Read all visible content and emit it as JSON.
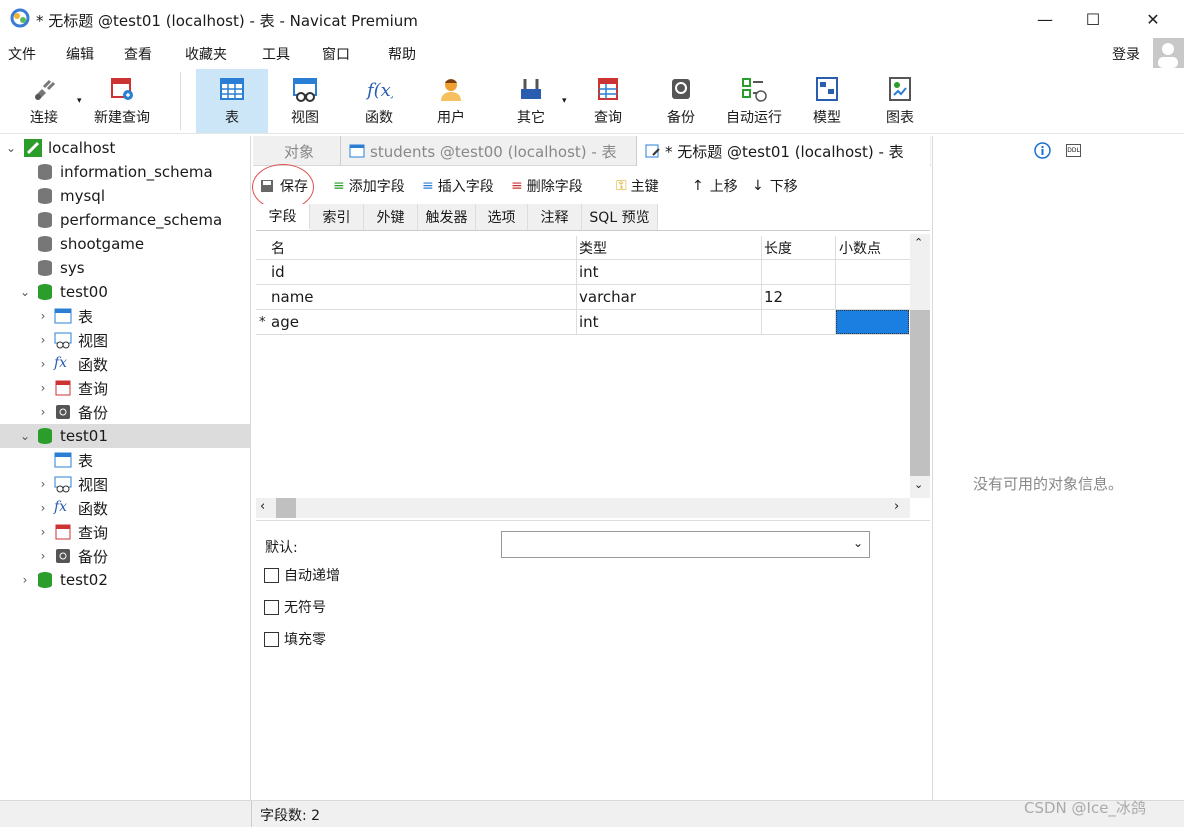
{
  "window": {
    "title": "* 无标题 @test01 (localhost) - 表 - Navicat Premium"
  },
  "menu": [
    "文件",
    "编辑",
    "查看",
    "收藏夹",
    "工具",
    "窗口",
    "帮助"
  ],
  "login": "登录",
  "toolbar": [
    "连接",
    "新建查询",
    "表",
    "视图",
    "函数",
    "用户",
    "其它",
    "查询",
    "备份",
    "自动运行",
    "模型",
    "图表"
  ],
  "tree": {
    "root": "localhost",
    "dbs_top": [
      "information_schema",
      "mysql",
      "performance_schema",
      "shootgame",
      "sys"
    ],
    "test00": "test00",
    "test00_children": [
      "表",
      "视图",
      "函数",
      "查询",
      "备份"
    ],
    "test01": "test01",
    "test01_children": [
      "表",
      "视图",
      "函数",
      "查询",
      "备份"
    ],
    "test02": "test02"
  },
  "tabs": {
    "objects": "对象",
    "t1": "students @test00 (localhost) - 表",
    "t2": "* 无标题 @test01 (localhost) - 表"
  },
  "edit_toolbar": {
    "save": "保存",
    "add": "添加字段",
    "insert": "插入字段",
    "delete": "删除字段",
    "pk": "主键",
    "up": "上移",
    "down": "下移"
  },
  "subtabs": [
    "字段",
    "索引",
    "外键",
    "触发器",
    "选项",
    "注释",
    "SQL 预览"
  ],
  "grid": {
    "headers": [
      "名",
      "类型",
      "长度",
      "小数点"
    ],
    "rows": [
      {
        "marker": "",
        "name": "id",
        "type": "int",
        "length": ""
      },
      {
        "marker": "",
        "name": "name",
        "type": "varchar",
        "length": "12"
      },
      {
        "marker": "*",
        "name": "age",
        "type": "int",
        "length": ""
      }
    ]
  },
  "props": {
    "default_label": "默认:",
    "auto_inc": "自动递增",
    "unsigned": "无符号",
    "zerofill": "填充零"
  },
  "right_panel": {
    "empty": "没有可用的对象信息。"
  },
  "status": {
    "field_count": "字段数: 2"
  },
  "watermark": "CSDN @Ice_冰鸽"
}
